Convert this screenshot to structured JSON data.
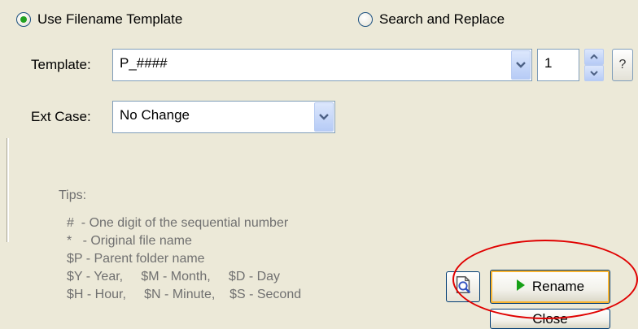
{
  "mode": {
    "use_filename_template": {
      "label": "Use Filename Template",
      "selected": true
    },
    "search_and_replace": {
      "label": "Search and Replace",
      "selected": false
    }
  },
  "template": {
    "label": "Template:",
    "value": "P_####",
    "dropdown_icon": "chevron-down-icon"
  },
  "start_number": {
    "value": "1",
    "spin_icon": "up-down-spinner-icon"
  },
  "help": {
    "label": "?"
  },
  "ext_case": {
    "label": "Ext Case:",
    "value": "No Change",
    "dropdown_icon": "chevron-down-icon"
  },
  "tips": {
    "title": "Tips:",
    "lines": [
      "#  - One digit of the sequential number",
      "*   - Original file name",
      "$P - Parent folder name",
      "$Y - Year,     $M - Month,     $D - Day",
      "$H - Hour,     $N - Minute,    $S - Second"
    ]
  },
  "buttons": {
    "preview_icon": "preview-magnifier-icon",
    "rename_label": "Rename",
    "rename_icon": "play-icon",
    "close_label": "Close"
  },
  "colors": {
    "background": "#ECE9D8",
    "radio_selected": "#21A121",
    "play_green": "#16A016",
    "highlight_ellipse": "#E00000",
    "tips_text": "#707070"
  }
}
